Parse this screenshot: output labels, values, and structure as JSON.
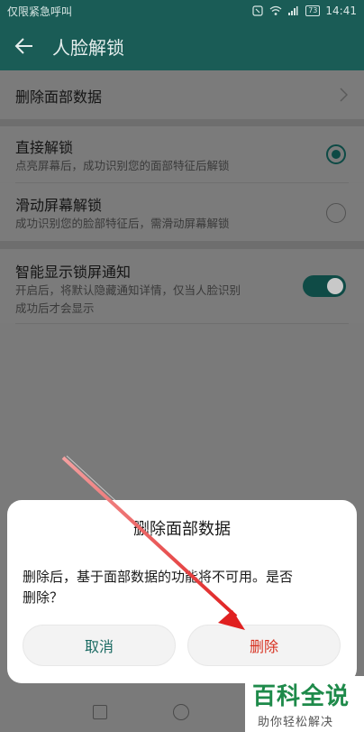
{
  "status_bar": {
    "carrier": "仅限紧急呼叫",
    "battery": "73",
    "time": "14:41",
    "icons": [
      "nfc-icon",
      "wifi-icon",
      "signal-icon",
      "battery-icon"
    ]
  },
  "app_bar": {
    "title": "人脸解锁",
    "back_icon": "arrow-left-icon"
  },
  "settings": {
    "delete_face_data": "删除面部数据",
    "direct_unlock": {
      "label": "直接解锁",
      "desc": "点亮屏幕后，成功识别您的面部特征后解锁",
      "selected": true
    },
    "swipe_unlock": {
      "label": "滑动屏幕解锁",
      "desc": "成功识别您的脸部特征后，需滑动屏幕解锁",
      "selected": false
    },
    "smart_notify": {
      "label": "智能显示锁屏通知",
      "desc_line1": "开启后，将默认隐藏通知详情，仅当人脸识别",
      "desc_line2": "成功后才会显示",
      "enabled": true
    }
  },
  "dialog": {
    "title": "删除面部数据",
    "message_line1": "删除后，基于面部数据的功能将不可用。是否",
    "message_line2": "删除？",
    "cancel": "取消",
    "delete": "删除"
  },
  "watermark": {
    "big": "百科全说",
    "small": "助你轻松解决"
  },
  "colors": {
    "accent": "#1a6a62",
    "danger": "#d7301f",
    "arrow": "#e02020"
  }
}
